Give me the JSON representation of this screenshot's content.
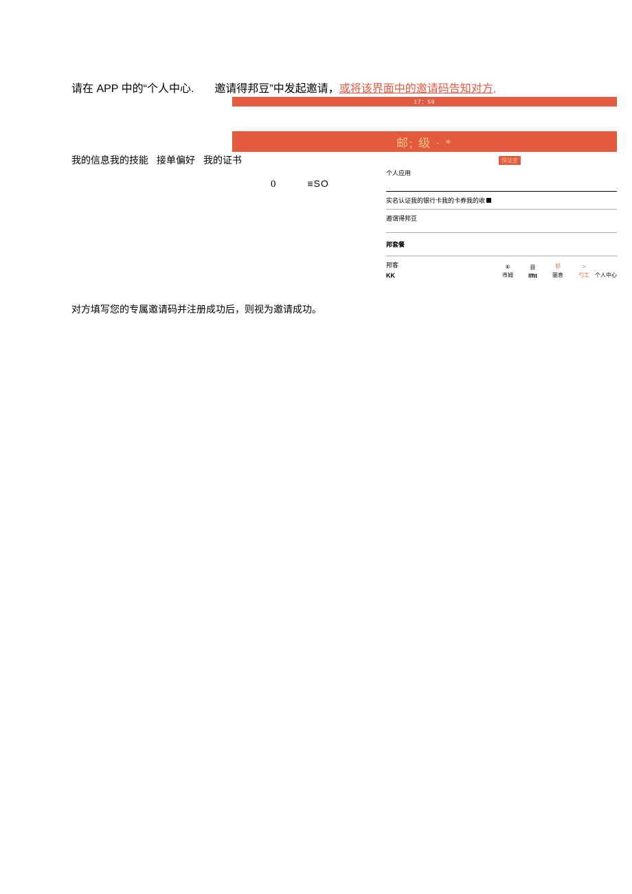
{
  "intro": {
    "part1": "请在 APP 中的“个人中心.",
    "part2_prefix": "邀请得邦豆”中发起邀请，",
    "part2_emph": "或将",
    "part2_suffix": "该界面中的邀请码告知对方,"
  },
  "orange_bars": {
    "time": "17：59",
    "header": "邮; 级 · *"
  },
  "tabs": {
    "a": "我的信息我的技能",
    "b": "接单偏好",
    "c": "我的证书"
  },
  "icons": {
    "o": "0",
    "so": "≡SO"
  },
  "panel": {
    "deposit": "保证金",
    "personal_app": "个人应用",
    "auth_row": "实名认证我的银行卡我的卡券我的收",
    "invite": "邀谓得邦豆",
    "package": "邦套餐",
    "bangke": "邦客",
    "kk": "KK"
  },
  "nav": {
    "item1_top": "⑥",
    "item1_label": "市姆",
    "item2_top": "目",
    "item2_label": "Ifftt",
    "item3_top": "祁",
    "item3_label": "丽息",
    "item4_top": ">",
    "item4_label": "勺工",
    "item4_sub": "个人中心"
  },
  "footer": "对方填写您的专属邀请码并注册成功后，则视为邀请成功。"
}
